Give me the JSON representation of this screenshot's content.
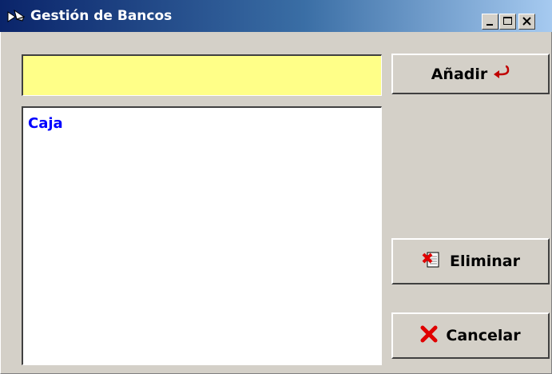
{
  "window": {
    "title": "Gestión de Bancos",
    "app_icon": "pen-icon",
    "controls": [
      "minimize-icon",
      "maximize-icon",
      "close-icon"
    ]
  },
  "form": {
    "name_value": "",
    "name_placeholder": "",
    "input_background": "#ffff88"
  },
  "bank_list": {
    "items": [
      "Caja"
    ],
    "item_color": "#0000ff"
  },
  "buttons": {
    "add_label": "Añadir",
    "add_icon": "return-arrow-icon",
    "delete_label": "Eliminar",
    "delete_icon": "delete-document-icon",
    "cancel_label": "Cancelar",
    "cancel_icon": "red-x-icon"
  }
}
